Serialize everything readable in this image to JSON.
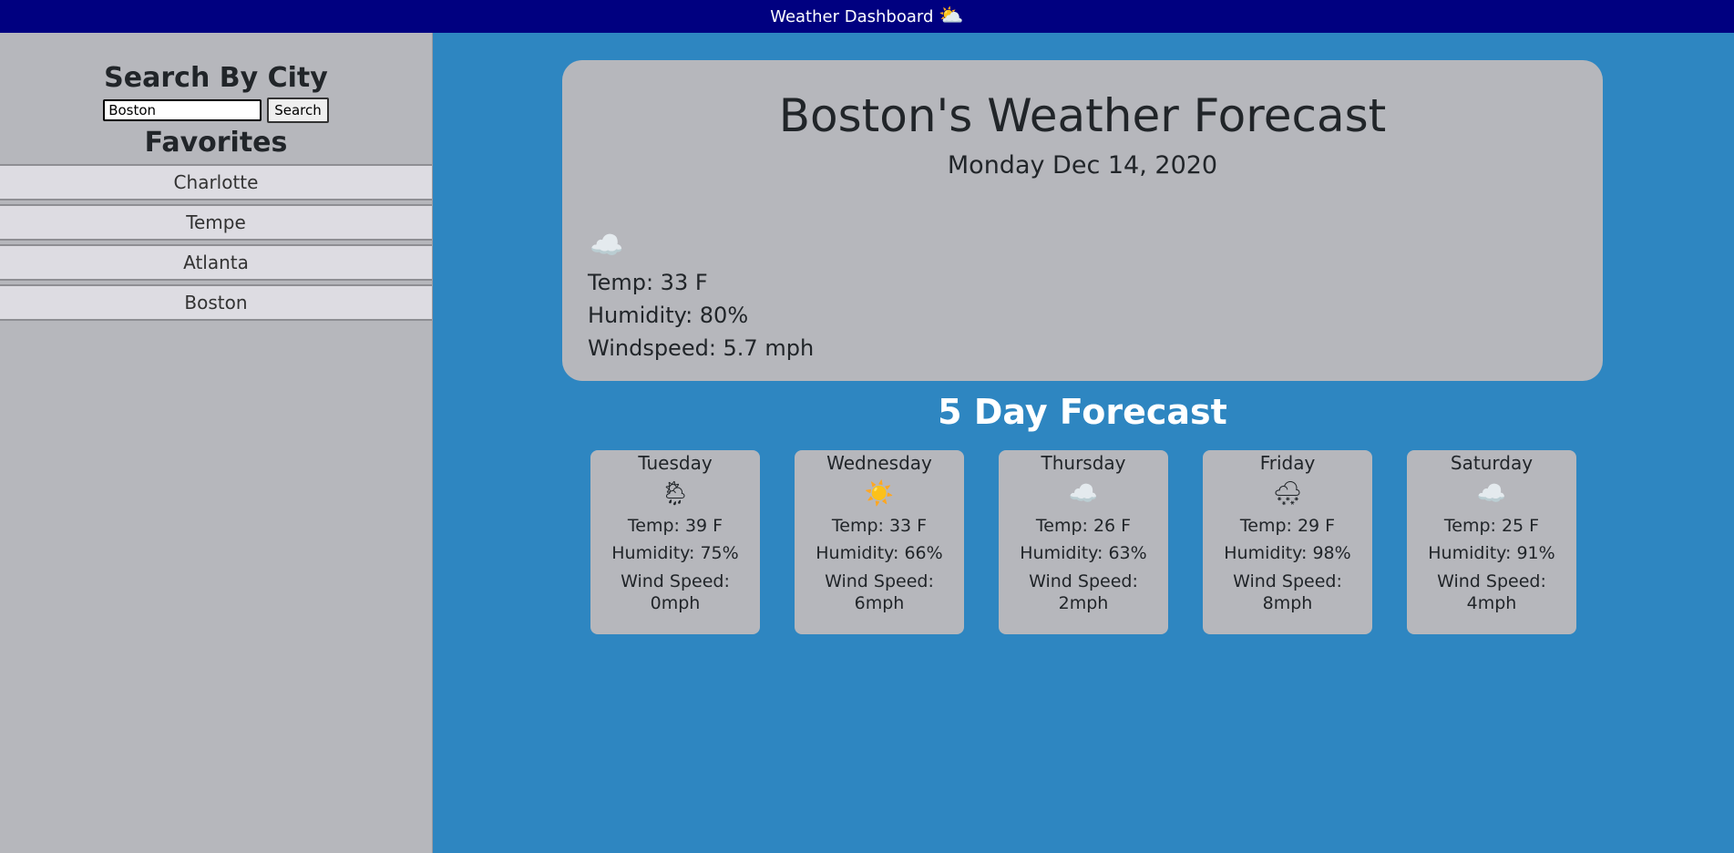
{
  "header": {
    "title": "Weather Dashboard",
    "icon": "sun-behind-cloud-icon"
  },
  "sidebar": {
    "search_title": "Search By City",
    "search_value": "Boston",
    "search_button": "Search",
    "favorites_title": "Favorites",
    "favorites": [
      "Charlotte",
      "Tempe",
      "Atlanta",
      "Boston"
    ]
  },
  "current": {
    "title": "Boston's Weather Forecast",
    "date": "Monday Dec 14, 2020",
    "icon": "cloud-moon-icon",
    "temp": "Temp: 33 F",
    "humidity": "Humidity: 80%",
    "windspeed": "Windspeed: 5.7 mph"
  },
  "forecast": {
    "title": "5 Day Forecast",
    "days": [
      {
        "day": "Tuesday",
        "icon": "rain-cloud-sun-icon",
        "temp": "Temp: 39 F",
        "humidity": "Humidity: 75%",
        "wind_label": "Wind Speed:",
        "wind_value": "0mph"
      },
      {
        "day": "Wednesday",
        "icon": "sun-icon",
        "temp": "Temp: 33 F",
        "humidity": "Humidity: 66%",
        "wind_label": "Wind Speed:",
        "wind_value": "6mph"
      },
      {
        "day": "Thursday",
        "icon": "cloud-icon",
        "temp": "Temp: 26 F",
        "humidity": "Humidity: 63%",
        "wind_label": "Wind Speed:",
        "wind_value": "2mph"
      },
      {
        "day": "Friday",
        "icon": "snow-cloud-icon",
        "temp": "Temp: 29 F",
        "humidity": "Humidity: 98%",
        "wind_label": "Wind Speed:",
        "wind_value": "8mph"
      },
      {
        "day": "Saturday",
        "icon": "cloud-icon",
        "temp": "Temp: 25 F",
        "humidity": "Humidity: 91%",
        "wind_label": "Wind Speed:",
        "wind_value": "4mph"
      }
    ]
  },
  "colors": {
    "header_bg": "#000080",
    "main_bg": "#2e86c1",
    "panel_bg": "#b6b7bc"
  }
}
